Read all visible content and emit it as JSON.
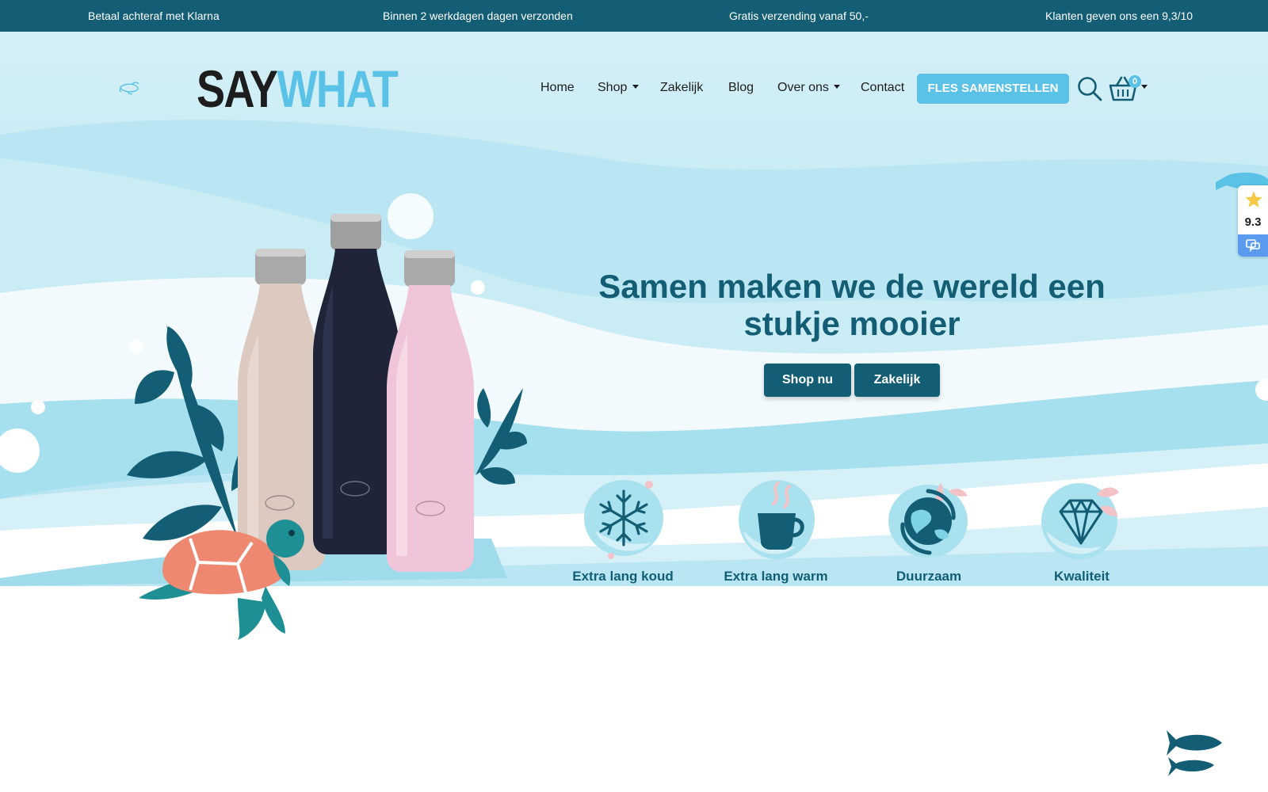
{
  "topbar": {
    "items": [
      "Betaal achteraf met Klarna",
      "Binnen 2 werkdagen dagen verzonden",
      "Gratis verzending vanaf 50,-",
      "Klanten geven ons een 9,3/10"
    ]
  },
  "brand": {
    "say": "SAY",
    "what": "WHAT"
  },
  "nav": {
    "home": "Home",
    "shop": "Shop",
    "zakelijk": "Zakelijk",
    "blog": "Blog",
    "over_ons": "Over ons",
    "contact": "Contact",
    "cta": "FLES SAMENSTELLEN",
    "cart_count": "0"
  },
  "hero": {
    "title": "Samen maken we de wereld een stukje mooier",
    "buttons": {
      "shop": "Shop nu",
      "zakelijk": "Zakelijk"
    }
  },
  "features": [
    {
      "label": "Extra lang koud",
      "icon": "snowflake-icon"
    },
    {
      "label": "Extra lang warm",
      "icon": "cup-icon"
    },
    {
      "label": "Duurzaam",
      "icon": "earth-icon"
    },
    {
      "label": "Kwaliteit",
      "icon": "diamond-icon"
    }
  ],
  "rating": {
    "score": "9.3"
  },
  "colors": {
    "primary": "#135e75",
    "accent": "#5bc2e7",
    "wave_light": "#d9f1f8",
    "wave_mid": "#aee3f0",
    "wave_dark": "#8ed6ea"
  }
}
